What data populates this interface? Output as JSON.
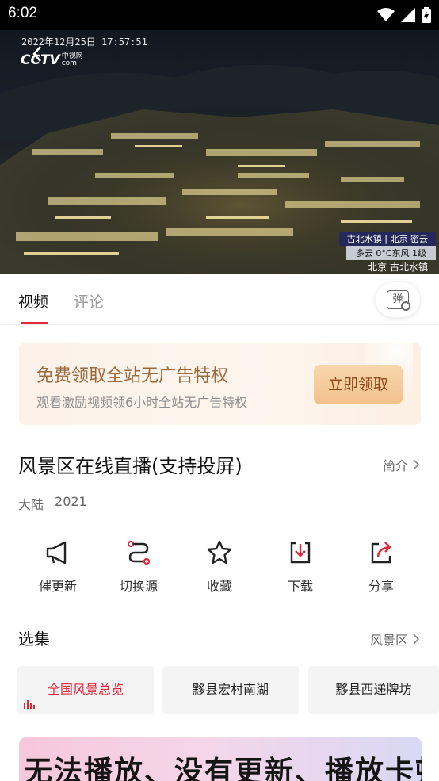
{
  "status_bar": {
    "time": "6:02",
    "icons": [
      "wifi-icon",
      "signal-icon",
      "battery-charging-icon"
    ]
  },
  "video": {
    "timestamp": "2022年12月25日  17:57:51",
    "logo_text": "CCTV",
    "logo_sub": "中视网",
    "logo_com": "com",
    "caption_location": "古北水镇 | 北京 密云",
    "caption_weather": "多云  0°C东风 1级",
    "caption_place": "北京 古北水镇"
  },
  "tabs": [
    {
      "label": "视频"
    },
    {
      "label": "评论"
    }
  ],
  "danmu_label": "弹",
  "promo": {
    "title": "免费领取全站无广告特权",
    "subtitle": "观看激励视频领6小时全站无广告特权",
    "button": "立即领取"
  },
  "show": {
    "title": "风景区在线直播(支持投屏)",
    "intro": "简介",
    "region": "大陆",
    "year": "2021"
  },
  "actions": [
    {
      "label": "催更新",
      "icon": "megaphone-icon"
    },
    {
      "label": "切换源",
      "icon": "switch-source-icon"
    },
    {
      "label": "收藏",
      "icon": "star-icon"
    },
    {
      "label": "下载",
      "icon": "download-icon"
    },
    {
      "label": "分享",
      "icon": "share-icon"
    }
  ],
  "episodes": {
    "title": "选集",
    "more": "风景区",
    "items": [
      {
        "label": "全国风景总览",
        "active": true
      },
      {
        "label": "黟县宏村南湖"
      },
      {
        "label": "黟县西递牌坊"
      }
    ]
  },
  "banner": {
    "text": "无法播放、没有更新、播放卡顿"
  },
  "colors": {
    "accent": "#e0283c",
    "promo_text": "#9a6a3e",
    "promo_button": "#f2c18c"
  }
}
